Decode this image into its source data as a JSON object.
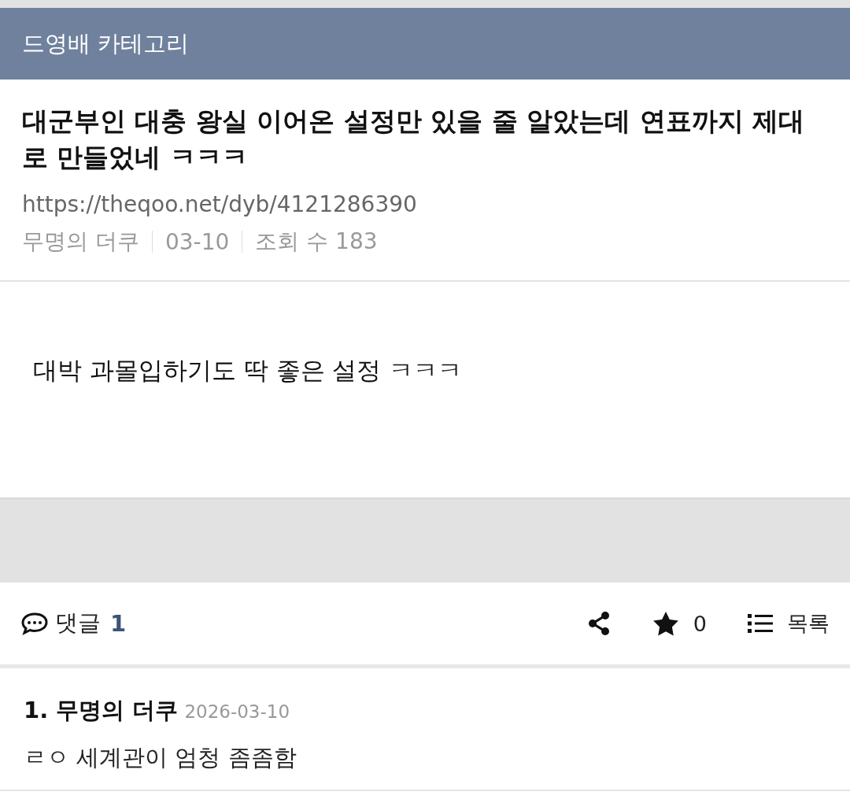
{
  "category_bar": {
    "title": "드영배 카테고리"
  },
  "post": {
    "title": "대군부인 대충 왕실 이어온 설정만 있을 줄 알았는데 연표까지 제대로 만들었네 ㅋㅋㅋ",
    "url": "https://theqoo.net/dyb/4121286390",
    "meta": [
      "무명의 더쿠",
      "03-10",
      "조회 수 183"
    ],
    "body": "대박 과몰입하기도 딱 좋은 설정 ㅋㅋㅋ"
  },
  "actions": {
    "comments_label": "댓글",
    "comments_count": "1",
    "stars_count": "0",
    "list_label": "목록"
  },
  "comments": [
    {
      "author": "1. 무명의 더쿠",
      "date": "2026-03-10",
      "text": "ㄹㅇ 세계관이 엄청 좀좀함"
    }
  ]
}
